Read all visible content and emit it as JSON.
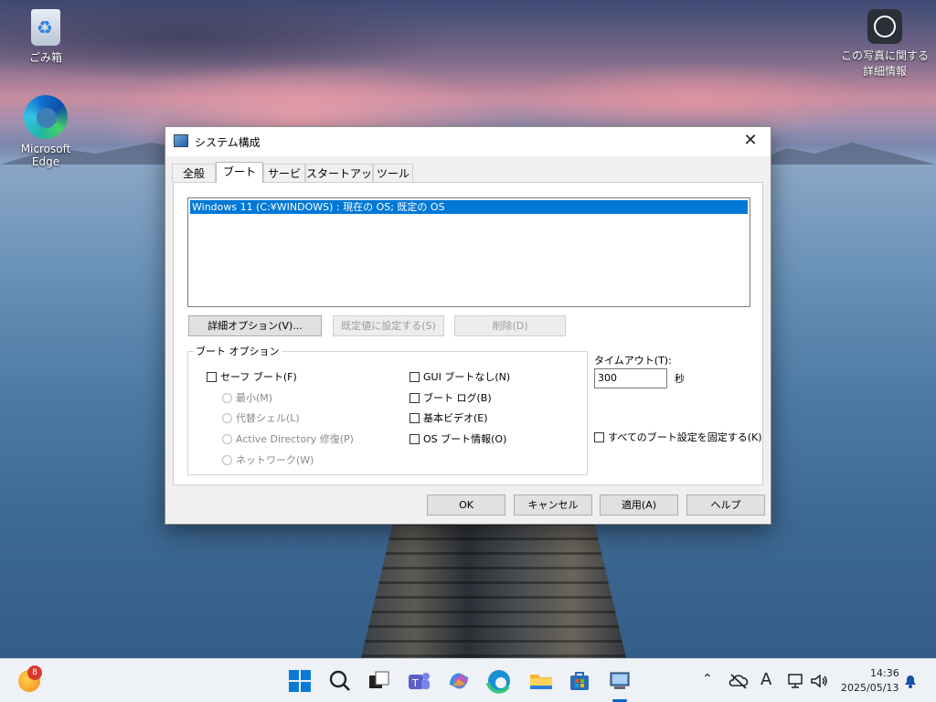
{
  "desktop": {
    "icons": [
      {
        "label": "ごみ箱"
      },
      {
        "label": "Microsoft Edge"
      },
      {
        "label": "この写真に関する詳細情報"
      }
    ]
  },
  "dialog": {
    "title": "システム構成",
    "close_glyph": "✕",
    "tabs": [
      "全般",
      "ブート",
      "サービス",
      "スタートアップ",
      "ツール"
    ],
    "active_tab": "ブート",
    "os_list": [
      "Windows 11 (C:¥WINDOWS) : 現在の OS; 既定の OS"
    ],
    "buttons": {
      "advanced": "詳細オプション(V)...",
      "set_default": "既定値に設定する(S)",
      "delete": "削除(D)"
    },
    "boot_options": {
      "legend": "ブート オプション",
      "safe_boot": "セーフ ブート(F)",
      "minimal": "最小(M)",
      "alternate_shell": "代替シェル(L)",
      "ad_repair": "Active Directory 修復(P)",
      "network": "ネットワーク(W)",
      "no_gui_boot": "GUI ブートなし(N)",
      "boot_log": "ブート ログ(B)",
      "base_video": "基本ビデオ(E)",
      "os_boot_info": "OS ブート情報(O)"
    },
    "timeout": {
      "label": "タイムアウト(T):",
      "value": "300",
      "unit": "秒"
    },
    "permanent_label": "すべてのブート設定を固定する(K)",
    "footer": {
      "ok": "OK",
      "cancel": "キャンセル",
      "apply": "適用(A)",
      "help": "ヘルプ"
    }
  },
  "taskbar": {
    "weather_badge": "8",
    "time": "14:36",
    "date": "2025/05/13",
    "ime": "A"
  },
  "colors": {
    "accent": "#0078d7",
    "taskbar": "#eef1f6",
    "dialog_bg": "#f0f0f0"
  }
}
